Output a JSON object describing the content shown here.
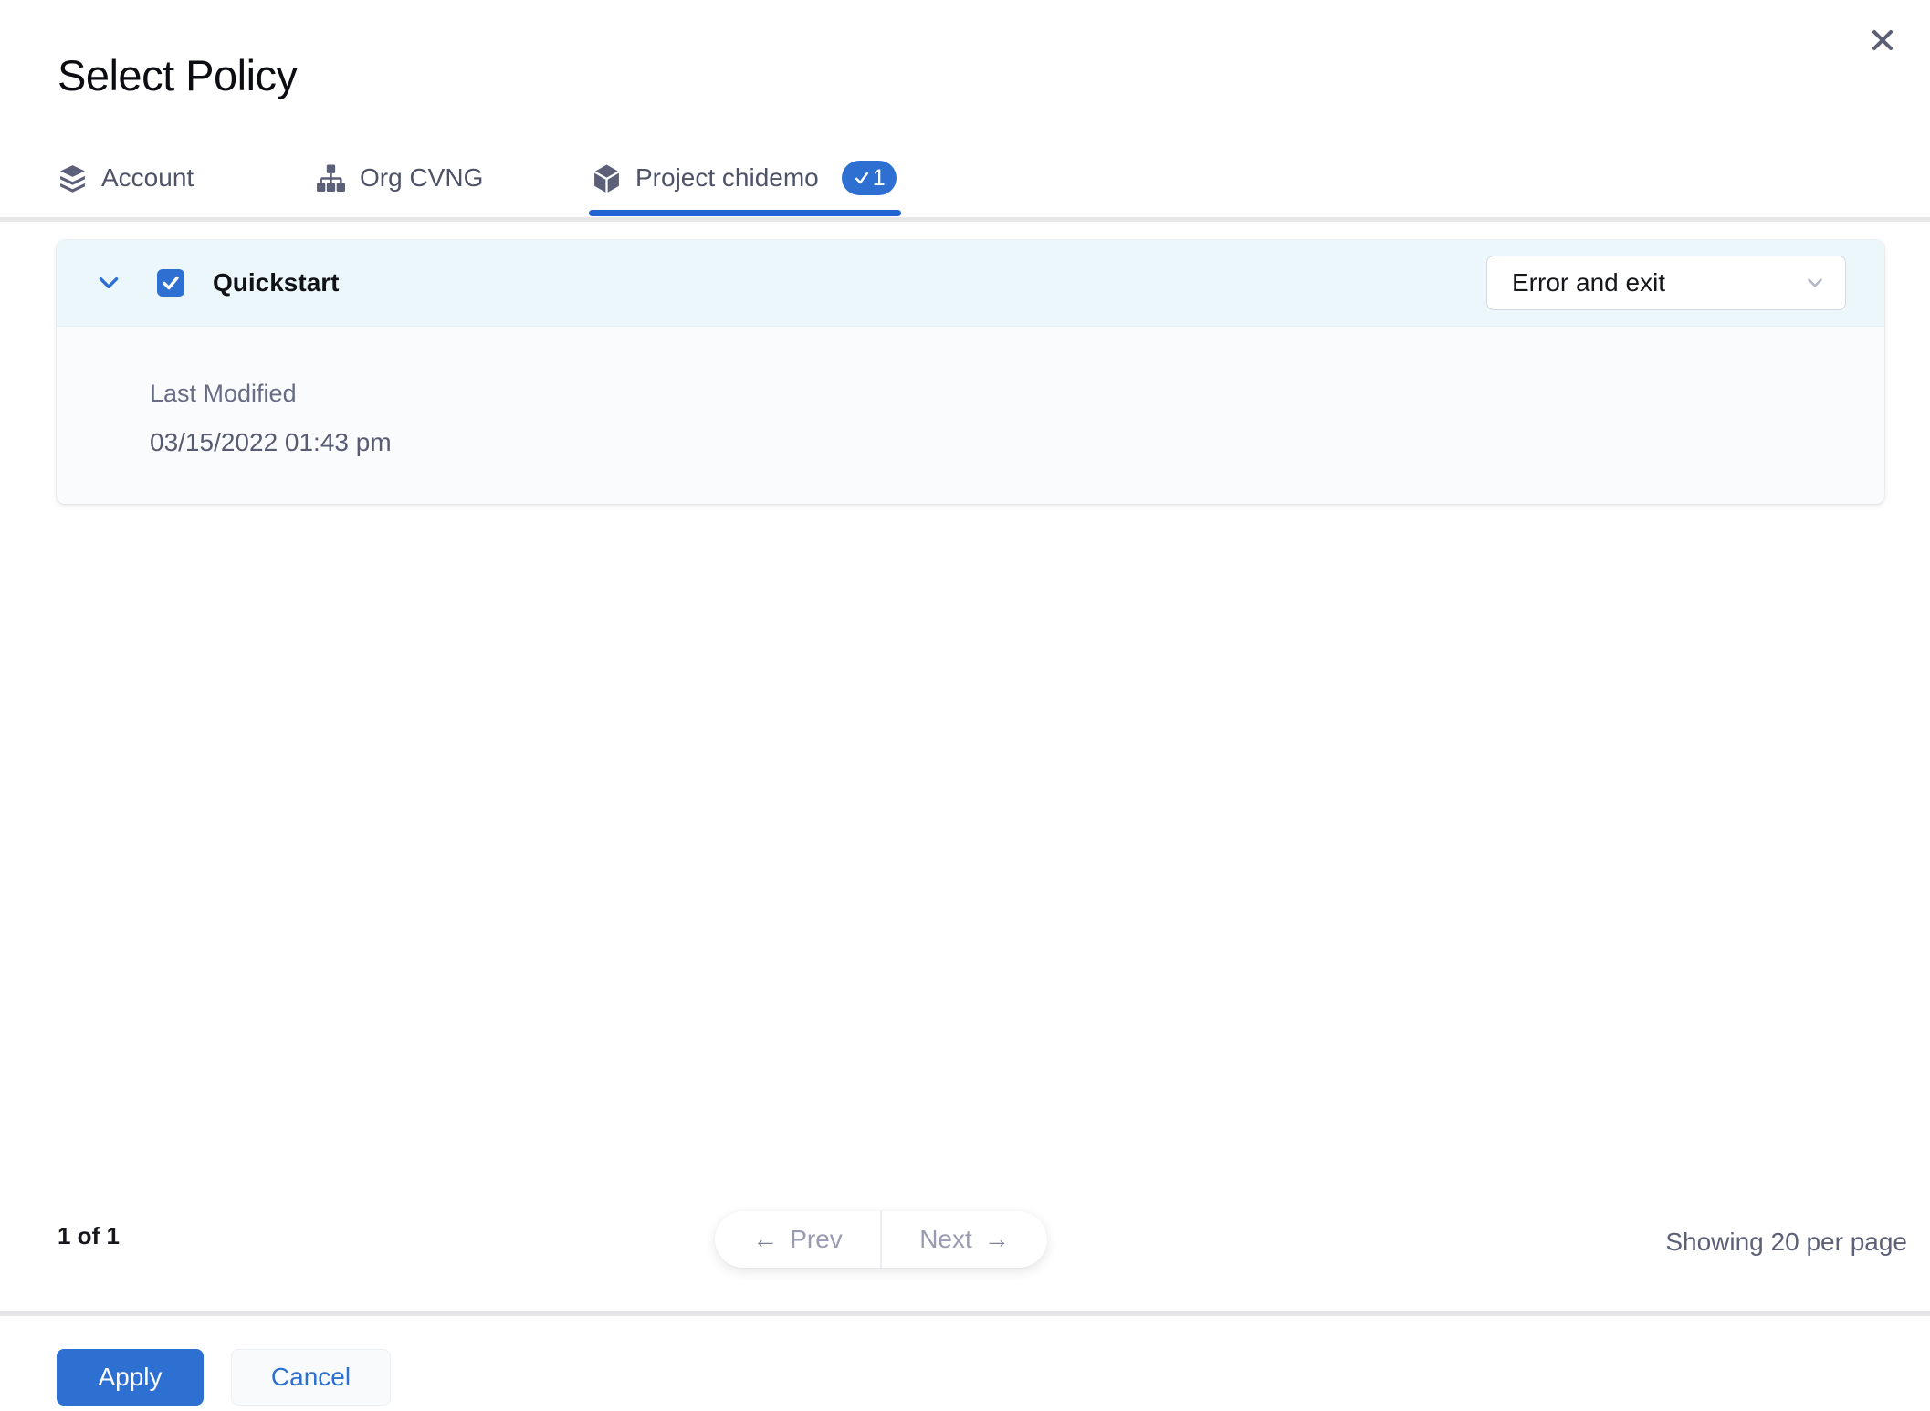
{
  "dialog": {
    "title": "Select Policy"
  },
  "tabs": {
    "account": {
      "label": "Account",
      "icon": "layers-icon"
    },
    "org": {
      "label": "Org CVNG",
      "icon": "hierarchy-icon"
    },
    "project": {
      "label": "Project chidemo",
      "icon": "cube-icon",
      "badge_count": "1",
      "active": true
    }
  },
  "policy": {
    "name": "Quickstart",
    "checked": true,
    "action": "Error and exit",
    "last_modified_label": "Last Modified",
    "last_modified_value": "03/15/2022 01:43 pm"
  },
  "pagination": {
    "page_info": "1 of 1",
    "prev_arrow": "←",
    "prev": "Prev",
    "next": "Next",
    "next_arrow": "→",
    "per_page": "Showing 20 per page"
  },
  "footer": {
    "apply": "Apply",
    "cancel": "Cancel"
  },
  "colors": {
    "primary": "#2e70d2",
    "tab_underline": "#2265d2",
    "selected_row_bg": "#ecf7fc",
    "card_body_bg": "#fafbfd",
    "divider": "#e7e7e8"
  }
}
